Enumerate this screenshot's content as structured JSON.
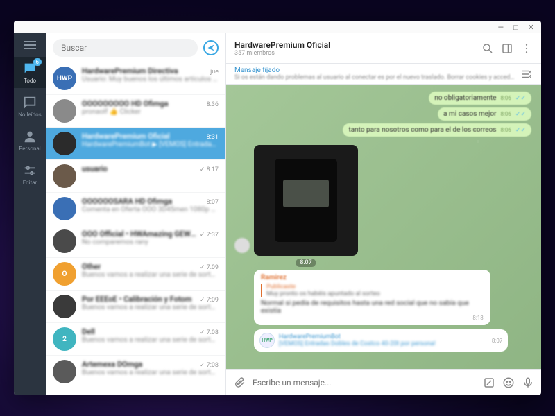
{
  "window_controls": {
    "min": "—",
    "max": "□",
    "close": "✕"
  },
  "rail": {
    "items": [
      {
        "key": "todo",
        "label": "Todo",
        "badge": "6"
      },
      {
        "key": "noleidos",
        "label": "No leídos"
      },
      {
        "key": "personal",
        "label": "Personal"
      },
      {
        "key": "editar",
        "label": "Editar"
      }
    ]
  },
  "search": {
    "placeholder": "Buscar"
  },
  "chats": [
    {
      "avatar_label": "HWP",
      "avatar_color": "#3a6fb5",
      "title": "HardwarePremium Directiva",
      "sub": "Usuario: Muy buenos los últimos artículos ba",
      "time": "jue"
    },
    {
      "avatar_label": "",
      "avatar_color": "#8a8a8a",
      "title": "OOOOOOOOO HD Ofimga",
      "sub": "pronaolf 👍 Clicker",
      "time": "8:36"
    },
    {
      "avatar_label": "",
      "avatar_color": "#2b2b2b",
      "title": "HardwarePremium Oficial",
      "sub": "HardwarePremiumBot ▶ [VEMOS] Entradas de",
      "time": "8:31",
      "selected": true
    },
    {
      "avatar_label": "",
      "avatar_color": "#6b5a4a",
      "title": "usuario",
      "sub": "",
      "time": "✓ 8:17"
    },
    {
      "avatar_label": "",
      "avatar_color": "#3a6fb5",
      "title": "OOOOOOSARA HD Ofimga",
      "sub": "Comenta en Oferta OOO 3D45men 1080p AXE",
      "time": "8:07"
    },
    {
      "avatar_label": "",
      "avatar_color": "#4a4a4a",
      "title": "OOO Official • HWAmazing GEWsan 🎬📱",
      "sub": "No comparemos rany",
      "time": "✓ 7:37"
    },
    {
      "avatar_label": "O",
      "avatar_color": "#f0a030",
      "title": "Other",
      "sub": "Buenos vamos a realizar una serie de sorteos en la",
      "time": "✓ 7:09"
    },
    {
      "avatar_label": "",
      "avatar_color": "#3a3a3a",
      "title": "Por EEEoE • Calibración y Fotom",
      "sub": "Buenos vamos a realizar una serie de sorteos e",
      "time": "✓ 7:09"
    },
    {
      "avatar_label": "2",
      "avatar_color": "#40b5c0",
      "title": "Dell",
      "sub": "Buenos vamos a realizar una serie de sorteos en la",
      "time": "✓ 7:08"
    },
    {
      "avatar_label": "",
      "avatar_color": "#5a5a5a",
      "title": "Artemexa DOmga",
      "sub": "Buenos vamos a realizar una serie de sorteos en l",
      "time": "✓ 7:08"
    }
  ],
  "conversation": {
    "title": "HardwarePremium Oficial",
    "subtitle": "357 miembros",
    "pinned": {
      "title": "Mensaje fijado",
      "body": "Si os están dando problemas al usuario al conectar es por el nuevo traslado. Borrar cookies y acceder de..."
    },
    "out_msgs": [
      {
        "text": "no obligatoriamente",
        "time": "8:06"
      },
      {
        "text": "a mi casos mejor",
        "time": "8:06"
      },
      {
        "text": "tanto para nosotros como para el de los correos",
        "time": "8:06"
      }
    ],
    "image_time": "8:07",
    "reply_msg": {
      "author": "Ramirez",
      "quote_title": "Publicaste",
      "quote_body": "Muy pronto os habéis apuntado al sorteo",
      "body": "Normal si pedía de requisitos hasta una red social que no sabía que existía",
      "time": "8:18"
    },
    "bot_msg": {
      "name": "HardwarePremiumBot",
      "avatar_text": "HWP",
      "body": "[VEMOS] Entradas Dobles de Costco 40-20t por persona!",
      "time": "8:07"
    },
    "composer_placeholder": "Escribe un mensaje..."
  }
}
